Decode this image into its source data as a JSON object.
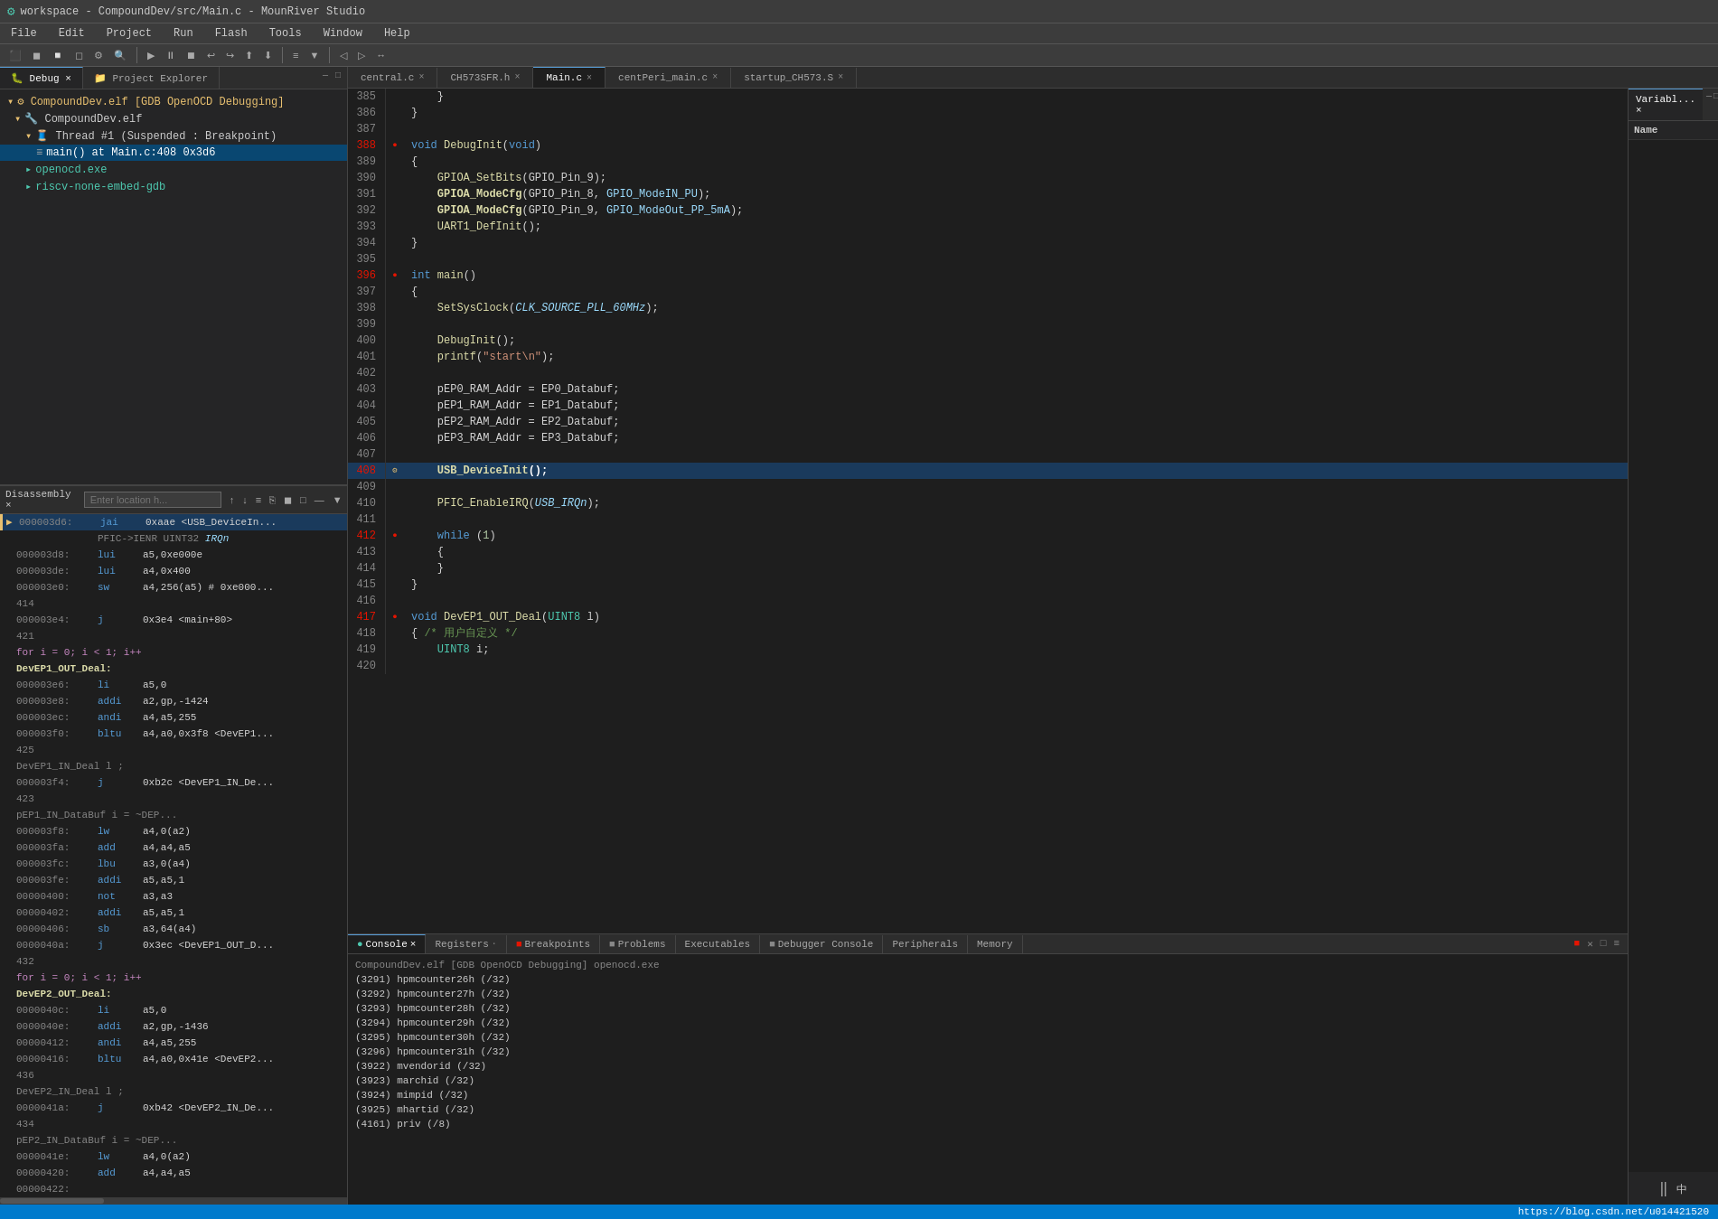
{
  "titleBar": {
    "icon": "⚙",
    "title": "workspace - CompoundDev/src/Main.c - MounRiver Studio"
  },
  "menuBar": {
    "items": [
      "File",
      "Edit",
      "Project",
      "Run",
      "Flash",
      "Tools",
      "Window",
      "Help"
    ]
  },
  "leftPanel": {
    "tabs": [
      {
        "label": "Debug",
        "active": true
      },
      {
        "label": "Project Explorer",
        "active": false
      }
    ],
    "tree": [
      {
        "indent": 0,
        "icon": "▾",
        "iconClass": "tree-icon-yellow",
        "text": "CompoundDev.elf [GDB OpenOCD Debugging]"
      },
      {
        "indent": 1,
        "icon": "▾",
        "iconClass": "tree-icon-yellow",
        "text": "CompoundDev.elf"
      },
      {
        "indent": 2,
        "icon": "▾",
        "iconClass": "tree-icon-yellow",
        "text": "Thread #1 (Suspended : Breakpoint)"
      },
      {
        "indent": 3,
        "icon": "=",
        "iconClass": "tree-icon-blue",
        "text": "main() at Main.c:408 0x3d6",
        "active": true
      },
      {
        "indent": 2,
        "icon": "▸",
        "iconClass": "tree-icon-green",
        "text": "openocd.exe"
      },
      {
        "indent": 2,
        "icon": "▸",
        "iconClass": "tree-icon-green",
        "text": "riscv-none-embed-gdb"
      }
    ],
    "disassembly": {
      "title": "Disassembly",
      "inputPlaceholder": "Enter location h...",
      "lines": [
        {
          "addr": "000003d6:",
          "arrow": "▶",
          "current": true,
          "mnem": "jai",
          "ops": "0xaae <USB_DeviceIn...",
          "comment": ""
        },
        {
          "addr": "",
          "arrow": "",
          "current": false,
          "mnem": "",
          "ops": "PFIC->IENR  UINT32  IRQn",
          "comment": ""
        },
        {
          "addr": "000003d8:",
          "arrow": "",
          "current": false,
          "mnem": "lui",
          "ops": "a5,0xe000e",
          "comment": ""
        },
        {
          "addr": "000003de:",
          "arrow": "",
          "current": false,
          "mnem": "lui",
          "ops": "a4,0x400",
          "comment": ""
        },
        {
          "addr": "000003e0:",
          "arrow": "",
          "current": false,
          "mnem": "sw",
          "ops": "a4,256(a5) # 0xe000...",
          "comment": ""
        },
        {
          "addr": "414",
          "label": true,
          "text": ""
        },
        {
          "addr": "000003e4:",
          "arrow": "",
          "current": false,
          "mnem": "j",
          "ops": "0x3e4 <main+80>",
          "comment": ""
        },
        {
          "addr": "421",
          "label": true,
          "text": ""
        },
        {
          "addr": "",
          "label2": true,
          "text": "for  i = 0; i < 1; i++"
        },
        {
          "addr": "",
          "label3": true,
          "text": "DevEP1_OUT_Deal:"
        },
        {
          "addr": "000003e6:",
          "arrow": "",
          "current": false,
          "mnem": "li",
          "ops": "a5,0",
          "comment": ""
        },
        {
          "addr": "000003e8:",
          "arrow": "",
          "current": false,
          "mnem": "addi",
          "ops": "a2,gp,-1424",
          "comment": ""
        },
        {
          "addr": "000003ec:",
          "arrow": "",
          "current": false,
          "mnem": "andi",
          "ops": "a4,a5,255",
          "comment": ""
        },
        {
          "addr": "000003f0:",
          "arrow": "",
          "current": false,
          "mnem": "bltu",
          "ops": "a4,a0,0x3f8 <DevEP1...",
          "comment": ""
        },
        {
          "addr": "425",
          "label": true,
          "text": ""
        },
        {
          "addr": "",
          "label2": true,
          "text": "DevEP1_IN_Deal l ;"
        },
        {
          "addr": "000003f4:",
          "arrow": "",
          "current": false,
          "mnem": "j",
          "ops": "0xb2c <DevEP1_IN_De...",
          "comment": ""
        },
        {
          "addr": "423",
          "label": true,
          "text": ""
        },
        {
          "addr": "",
          "label2": true,
          "text": "pEP1_IN_DataBuf i = ~DEP..."
        },
        {
          "addr": "000003f8:",
          "arrow": "",
          "current": false,
          "mnem": "lw",
          "ops": "a4,0(a2)",
          "comment": ""
        },
        {
          "addr": "000003fa:",
          "arrow": "",
          "current": false,
          "mnem": "add",
          "ops": "a4,a4,a5",
          "comment": ""
        },
        {
          "addr": "000003fc:",
          "arrow": "",
          "current": false,
          "mnem": "lbu",
          "ops": "a3,0(a4)",
          "comment": ""
        },
        {
          "addr": "000003fe:",
          "arrow": "",
          "current": false,
          "mnem": "addi",
          "ops": "a5,a5,1",
          "comment": ""
        },
        {
          "addr": "00000400:",
          "arrow": "",
          "current": false,
          "mnem": "not",
          "ops": "a3,a3",
          "comment": ""
        },
        {
          "addr": "00000402:",
          "arrow": "",
          "current": false,
          "mnem": "addi",
          "ops": "a5,a5,1",
          "comment": ""
        },
        {
          "addr": "00000406:",
          "arrow": "",
          "current": false,
          "mnem": "sb",
          "ops": "a3,64(a4)",
          "comment": ""
        },
        {
          "addr": "0000040a:",
          "arrow": "",
          "current": false,
          "mnem": "j",
          "ops": "0x3ec <DevEP1_OUT_D...",
          "comment": ""
        },
        {
          "addr": "432",
          "label": true,
          "text": ""
        },
        {
          "addr": "",
          "label2": true,
          "text": "for  i = 0; i < 1; i++"
        },
        {
          "addr": "",
          "label3": true,
          "text": "DevEP2_OUT_Deal:"
        },
        {
          "addr": "0000040c:",
          "arrow": "",
          "current": false,
          "mnem": "li",
          "ops": "a5,0",
          "comment": ""
        },
        {
          "addr": "0000040e:",
          "arrow": "",
          "current": false,
          "mnem": "addi",
          "ops": "a2,gp,-1436",
          "comment": ""
        },
        {
          "addr": "00000412:",
          "arrow": "",
          "current": false,
          "mnem": "andi",
          "ops": "a4,a5,255",
          "comment": ""
        },
        {
          "addr": "00000416:",
          "arrow": "",
          "current": false,
          "mnem": "bltu",
          "ops": "a4,a0,0x41e <DevEP2...",
          "comment": ""
        },
        {
          "addr": "436",
          "label": true,
          "text": ""
        },
        {
          "addr": "",
          "label2": true,
          "text": "DevEP2_IN_Deal l ;"
        },
        {
          "addr": "0000041a:",
          "arrow": "",
          "current": false,
          "mnem": "j",
          "ops": "0xb42 <DevEP2_IN_De...",
          "comment": ""
        },
        {
          "addr": "434",
          "label": true,
          "text": ""
        },
        {
          "addr": "",
          "label2": true,
          "text": "pEP2_IN_DataBuf i = ~DEP..."
        },
        {
          "addr": "0000041e:",
          "arrow": "",
          "current": false,
          "mnem": "lw",
          "ops": "a4,0(a2)",
          "comment": ""
        },
        {
          "addr": "00000420:",
          "arrow": "",
          "current": false,
          "mnem": "add",
          "ops": "a4,a4,a5",
          "comment": ""
        },
        {
          "addr": "00000422:",
          "arrow": "",
          "current": false,
          "mnem": "",
          "ops": "",
          "comment": ""
        }
      ]
    }
  },
  "editorTabs": [
    {
      "label": "central.c",
      "modified": false,
      "active": false
    },
    {
      "label": "CH573SFR.h",
      "modified": false,
      "active": false
    },
    {
      "label": "Main.c",
      "modified": false,
      "active": true
    },
    {
      "label": "centPeri_main.c",
      "modified": false,
      "active": false
    },
    {
      "label": "startup_CH573.S",
      "modified": false,
      "active": false
    }
  ],
  "codeLines": [
    {
      "num": "385",
      "code": "    }",
      "type": "normal"
    },
    {
      "num": "386",
      "code": "}",
      "type": "normal"
    },
    {
      "num": "387",
      "code": "",
      "type": "normal"
    },
    {
      "num": "388",
      "code": "void DebugInit(void)",
      "type": "normal",
      "hasBreakpoint": true
    },
    {
      "num": "389",
      "code": "{",
      "type": "normal"
    },
    {
      "num": "390",
      "code": "    GPIOA_SetBits(GPIO_Pin_9);",
      "type": "normal"
    },
    {
      "num": "391",
      "code": "    GPIOA_ModeCfg(GPIO_Pin_8, GPIO_ModeIN_PU);",
      "type": "normal"
    },
    {
      "num": "392",
      "code": "    GPIOA_ModeCfg(GPIO_Pin_9, GPIO_ModeOut_PP_5mA);",
      "type": "normal"
    },
    {
      "num": "393",
      "code": "    UART1_DefInit();",
      "type": "normal"
    },
    {
      "num": "394",
      "code": "}",
      "type": "normal"
    },
    {
      "num": "395",
      "code": "",
      "type": "normal"
    },
    {
      "num": "396",
      "code": "int main()",
      "type": "normal",
      "hasBreakpoint": true
    },
    {
      "num": "397",
      "code": "{",
      "type": "normal"
    },
    {
      "num": "398",
      "code": "    SetSysClock(CLK_SOURCE_PLL_60MHz);",
      "type": "normal"
    },
    {
      "num": "399",
      "code": "",
      "type": "normal"
    },
    {
      "num": "400",
      "code": "    DebugInit();",
      "type": "normal"
    },
    {
      "num": "401",
      "code": "    printf(\"start\\n\");",
      "type": "normal"
    },
    {
      "num": "402",
      "code": "",
      "type": "normal"
    },
    {
      "num": "403",
      "code": "    pEP0_RAM_Addr = EP0_Databuf;",
      "type": "normal"
    },
    {
      "num": "404",
      "code": "    pEP1_RAM_Addr = EP1_Databuf;",
      "type": "normal"
    },
    {
      "num": "405",
      "code": "    pEP2_RAM_Addr = EP2_Databuf;",
      "type": "normal"
    },
    {
      "num": "406",
      "code": "    pEP3_RAM_Addr = EP3_Databuf;",
      "type": "normal"
    },
    {
      "num": "407",
      "code": "",
      "type": "normal"
    },
    {
      "num": "408",
      "code": "    USB_DeviceInit();",
      "type": "debug",
      "hasDebugArrow": true,
      "hasBreakpoint": true
    },
    {
      "num": "409",
      "code": "",
      "type": "normal"
    },
    {
      "num": "410",
      "code": "    PFIC_EnableIRQ(USB_IRQn);",
      "type": "normal"
    },
    {
      "num": "411",
      "code": "",
      "type": "normal"
    },
    {
      "num": "412",
      "code": "    while (1)",
      "type": "normal",
      "hasBreakpoint": true
    },
    {
      "num": "413",
      "code": "    {",
      "type": "normal"
    },
    {
      "num": "414",
      "code": "    }",
      "type": "normal"
    },
    {
      "num": "415",
      "code": "}",
      "type": "normal"
    },
    {
      "num": "416",
      "code": "",
      "type": "normal"
    },
    {
      "num": "417",
      "code": "void DevEP1_OUT_Deal(UINT8 l)",
      "type": "normal",
      "hasBreakpoint": true
    },
    {
      "num": "418",
      "code": "{ /* 用户自定义 */",
      "type": "normal"
    },
    {
      "num": "419",
      "code": "    UINT8 i;",
      "type": "normal"
    },
    {
      "num": "420",
      "code": "",
      "type": "normal"
    }
  ],
  "variablesPanel": {
    "tab": "Variabl...",
    "header": "Name",
    "controls": [
      "—",
      "□",
      "✕"
    ]
  },
  "consoleTabs": [
    {
      "label": "Console",
      "active": true,
      "dot": "●"
    },
    {
      "label": "Registers",
      "active": false
    },
    {
      "label": "Breakpoints",
      "active": false,
      "dot": "■"
    },
    {
      "label": "Problems",
      "active": false,
      "dot": "■"
    },
    {
      "label": "Executables",
      "active": false
    },
    {
      "label": "Debugger Console",
      "active": false,
      "dot": "■"
    },
    {
      "label": "Peripherals",
      "active": false
    },
    {
      "label": "Memory",
      "active": false
    }
  ],
  "consoleHeader": "CompoundDev.elf [GDB OpenOCD Debugging] openocd.exe",
  "consoleLines": [
    "(3291) hpmcounter26h (/32)",
    "(3292) hpmcounter27h (/32)",
    "(3293) hpmcounter28h (/32)",
    "(3294) hpmcounter29h (/32)",
    "(3295) hpmcounter30h (/32)",
    "(3296) hpmcounter31h (/32)",
    "(3922) mvendorid (/32)",
    "(3923) marchid (/32)",
    "(3924) mimpid (/32)",
    "(3925) mhartid (/32)",
    "(4161) priv (/8)"
  ],
  "statusBar": {
    "url": "https://blog.csdn.net/u014421520"
  }
}
